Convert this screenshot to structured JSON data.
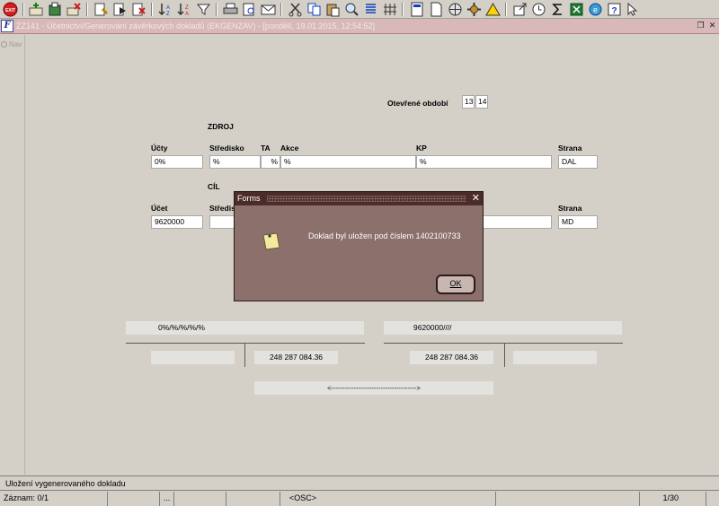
{
  "toolbar": {
    "icons": [
      "exit-icon",
      "insert-record-icon",
      "save-record-icon",
      "delete-record-icon",
      "query-icon",
      "execute-query-icon",
      "cancel-query-icon",
      "sort-asc-icon",
      "sort-desc-icon",
      "filter-icon",
      "print-icon",
      "print-preview-icon",
      "mail-icon",
      "cut-icon",
      "copy-icon",
      "paste-icon",
      "find-icon",
      "list-icon",
      "columns-icon",
      "calculator-icon",
      "document-icon",
      "globe-icon",
      "settings-icon",
      "warning-icon",
      "export-icon",
      "clock-icon",
      "sum-icon",
      "excel-icon",
      "browser-icon",
      "help-icon"
    ],
    "exit_label": "EXIT"
  },
  "window": {
    "title": "ZZ141 - Účetnictví/Generování závěrkových dokladů (EKGENZAV) - [pondělí, 19.01.2015, 12:54:52]",
    "forms_icon_label": "F"
  },
  "nav": {
    "label": "Nav"
  },
  "form": {
    "period_label": "Otevřené období",
    "period_from": "13",
    "period_to": "14",
    "source_heading": "ZDROJ",
    "target_heading": "CÍL",
    "source": {
      "ucty_label": "Účty",
      "ucty_value": "0%",
      "stredisko_label": "Středisko",
      "stredisko_value": "%",
      "ta_label": "TA",
      "ta_value": "%",
      "akce_label": "Akce",
      "akce_value": "%",
      "kp_label": "KP",
      "kp_value": "%",
      "strana_label": "Strana",
      "strana_value": "DAL"
    },
    "target": {
      "ucet_label": "Účet",
      "ucet_value": "9620000",
      "stredisko_label": "Středis",
      "strana_label": "Strana",
      "strana_value": "MD"
    },
    "summary": {
      "left_mask": "0%/%/%/%/%",
      "right_mask": "9620000////",
      "left_amount": "248 287 084.36",
      "right_amount": "248 287 084.36",
      "arrow": "<-------------------------------------->"
    }
  },
  "dialog": {
    "title": "Forms",
    "message": "Doklad byl uložen pod číslem 1402100733",
    "ok_label": "OK",
    "close_glyph": "✕"
  },
  "status": {
    "message": "Uložení vygenerovaného dokladu",
    "record": "Záznam: 0/1",
    "ellipsis": "...",
    "osc": "<OSC>",
    "page": "1/30"
  },
  "colors": {
    "dialog_bg": "#8c706c",
    "dialog_title": "#4c2c28",
    "window_bar": "#d8b8b8",
    "exit_red": "#d02020"
  }
}
